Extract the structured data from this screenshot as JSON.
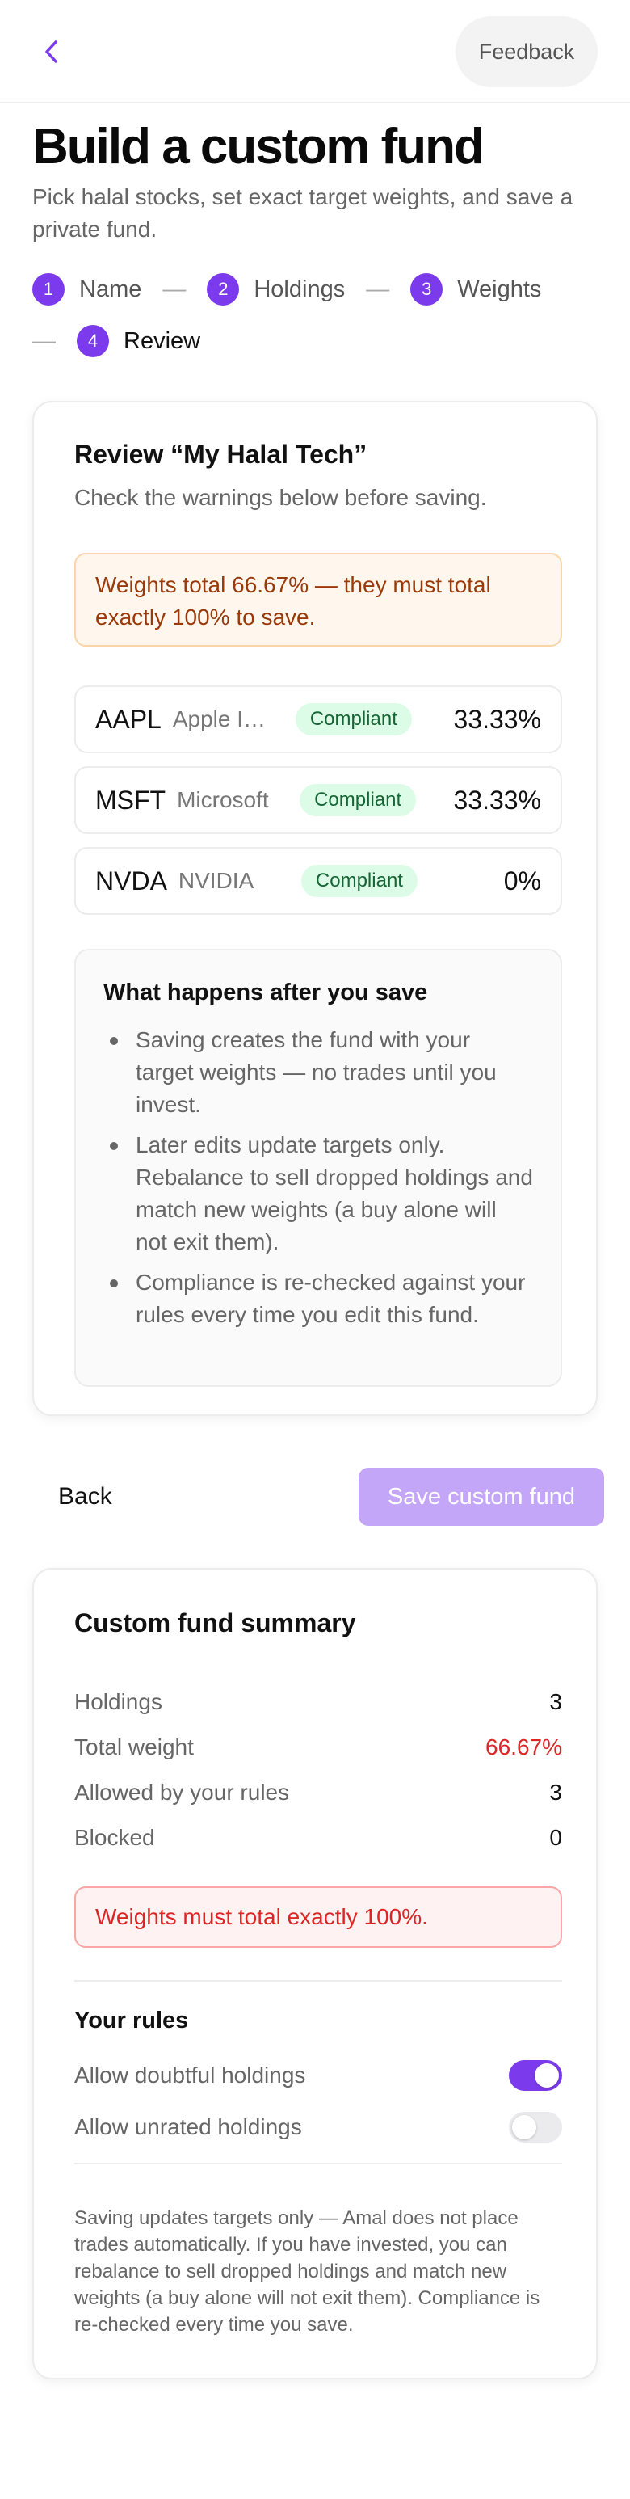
{
  "header": {
    "back_icon": "chevron-left-icon",
    "feedback_label": "Feedback",
    "accent_color": "#7c3aed"
  },
  "page": {
    "title": "Build a custom fund",
    "subtitle": "Pick halal stocks, set exact target weights, and save a private fund."
  },
  "steps": [
    {
      "num": "1",
      "label": "Name"
    },
    {
      "num": "2",
      "label": "Holdings"
    },
    {
      "num": "3",
      "label": "Weights"
    },
    {
      "num": "4",
      "label": "Review"
    }
  ],
  "step_separator": "—",
  "review": {
    "title": "Review “My Halal Tech”",
    "subtitle": "Check the warnings below before saving.",
    "warning": "Weights total 66.67% — they must total exactly 100% to save.",
    "holdings": [
      {
        "ticker": "AAPL",
        "name": "Apple Inc.",
        "status": "Compliant",
        "weight": "33.33%"
      },
      {
        "ticker": "MSFT",
        "name": "Microsoft",
        "status": "Compliant",
        "weight": "33.33%"
      },
      {
        "ticker": "NVDA",
        "name": "NVIDIA",
        "status": "Compliant",
        "weight": "0%"
      }
    ],
    "after_title": "What happens after you save",
    "after_items": [
      "Saving creates the fund with your target weights — no trades until you invest.",
      "Later edits update targets only. Rebalance to sell dropped holdings and match new weights (a buy alone will not exit them).",
      "Compliance is re-checked against your rules every time you edit this fund."
    ]
  },
  "actions": {
    "back_label": "Back",
    "save_label": "Save custom fund"
  },
  "summary": {
    "title": "Custom fund summary",
    "rows": [
      {
        "label": "Holdings",
        "value": "3"
      },
      {
        "label": "Total weight",
        "value": "66.67%"
      },
      {
        "label": "Allowed by your rules",
        "value": "3"
      },
      {
        "label": "Blocked",
        "value": "0"
      }
    ],
    "error": "Weights must total exactly 100%.",
    "rules_title": "Your rules",
    "rules": [
      {
        "label": "Allow doubtful holdings",
        "enabled": true
      },
      {
        "label": "Allow unrated holdings",
        "enabled": false
      }
    ],
    "footnote": "Saving updates targets only — Amal does not place trades automatically. If you have invested, you can rebalance to sell dropped holdings and match new weights (a buy alone will not exit them). Compliance is re-checked every time you save."
  }
}
